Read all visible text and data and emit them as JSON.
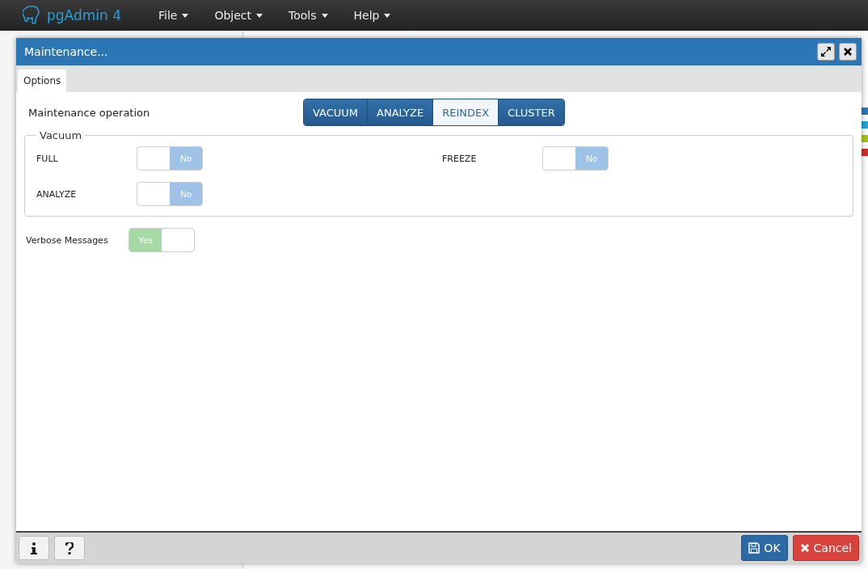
{
  "navbar": {
    "brand": "pgAdmin 4",
    "menus": [
      {
        "label": "File"
      },
      {
        "label": "Object"
      },
      {
        "label": "Tools"
      },
      {
        "label": "Help"
      }
    ]
  },
  "dialog": {
    "title": "Maintenance...",
    "tabs": [
      {
        "label": "Options",
        "selected": true
      }
    ],
    "operation": {
      "label": "Maintenance operation",
      "options": [
        {
          "label": "VACUUM",
          "selected": false
        },
        {
          "label": "ANALYZE",
          "selected": false
        },
        {
          "label": "REINDEX",
          "selected": true
        },
        {
          "label": "CLUSTER",
          "selected": false
        }
      ]
    },
    "vacuum": {
      "legend": "Vacuum",
      "switches": [
        {
          "label": "FULL",
          "on": false,
          "text": "No"
        },
        {
          "label": "FREEZE",
          "on": false,
          "text": "No"
        },
        {
          "label": "ANALYZE",
          "on": false,
          "text": "No"
        }
      ]
    },
    "verbose": {
      "label": "Verbose Messages",
      "on": true,
      "text": "Yes"
    },
    "footer": {
      "ok": "OK",
      "cancel": "Cancel"
    }
  }
}
